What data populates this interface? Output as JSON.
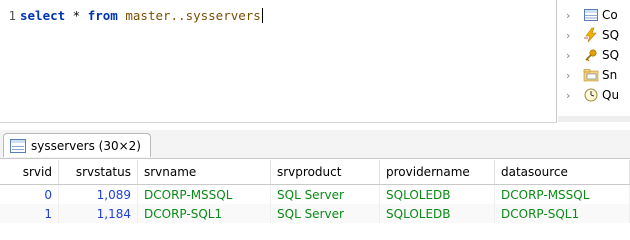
{
  "editor": {
    "line_number": "1",
    "tokens": {
      "select": "select",
      "star": " * ",
      "from": "from",
      "table": " master..sysservers"
    }
  },
  "tree": {
    "items": [
      {
        "label": "Co",
        "icon": "table-icon"
      },
      {
        "label": "SQ",
        "icon": "sql-lightning-icon"
      },
      {
        "label": "SQ",
        "icon": "sql-key-icon"
      },
      {
        "label": "Sn",
        "icon": "snippet-folder-icon"
      },
      {
        "label": "Qu",
        "icon": "query-clock-icon"
      }
    ]
  },
  "results": {
    "tab_label": "sysservers (30×2)",
    "columns": [
      "srvid",
      "srvstatus",
      "srvname",
      "srvproduct",
      "providername",
      "datasource"
    ],
    "rows": [
      {
        "srvid": "0",
        "srvstatus": "1,089",
        "srvname": "DCORP-MSSQL",
        "srvproduct": "SQL Server",
        "providername": "SQLOLEDB",
        "datasource": "DCORP-MSSQL"
      },
      {
        "srvid": "1",
        "srvstatus": "1,184",
        "srvname": "DCORP-SQL1",
        "srvproduct": "SQL Server",
        "providername": "SQLOLEDB",
        "datasource": "DCORP-SQL1"
      }
    ]
  },
  "colors": {
    "keyword": "#0033b3",
    "number": "#1f3fd8",
    "string": "#0a8a16"
  }
}
